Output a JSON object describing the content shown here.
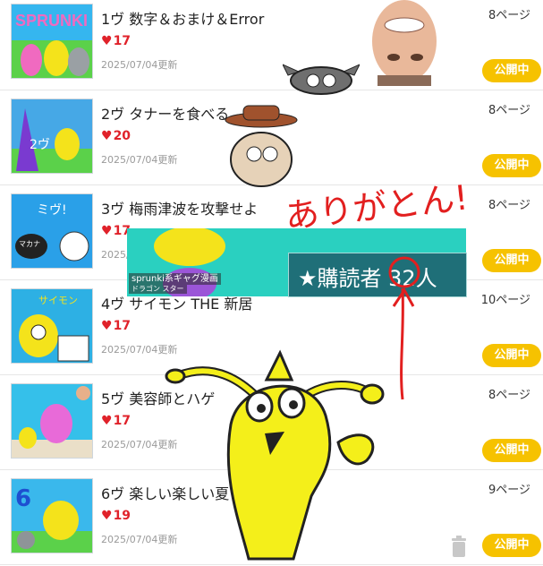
{
  "items": [
    {
      "title": "1ヴ 数字＆おまけ＆Error",
      "likes": "17",
      "updated": "2025/07/04更新",
      "pages": "8ページ",
      "status": "公開中"
    },
    {
      "title": "2ヴ タナーを食べる",
      "likes": "20",
      "updated": "2025/07/04更新",
      "pages": "8ページ",
      "status": "公開中"
    },
    {
      "title": "3ヴ 梅雨津波を攻撃せよ",
      "likes": "17",
      "updated": "2025/07/04更新",
      "pages": "8ページ",
      "status": "公開中"
    },
    {
      "title": "4ヴ サイモン THE 新居",
      "likes": "17",
      "updated": "2025/07/04更新",
      "pages": "10ページ",
      "status": "公開中"
    },
    {
      "title": "5ヴ 美容師とハゲ",
      "likes": "17",
      "updated": "2025/07/04更新",
      "pages": "8ページ",
      "status": "公開中"
    },
    {
      "title": "6ヴ 楽しい楽しい夏！",
      "likes": "19",
      "updated": "2025/07/04更新",
      "pages": "9ページ",
      "status": "公開中"
    }
  ],
  "thumbs": [
    "SPRUNKI",
    "2ヴ",
    "ミヴ! マカナダンス",
    "サイモン 新居 クイズ",
    "",
    "6"
  ],
  "overlay": {
    "banner_title": "sprunki系ギャグ漫画",
    "banner_author": "ドラゴン スター",
    "subscribers": "★購読者 32人",
    "thanks": "ありがとん!"
  },
  "colors": {
    "accent": "#f6c200",
    "heart": "#e0222a",
    "annotation": "#e21f1f"
  }
}
